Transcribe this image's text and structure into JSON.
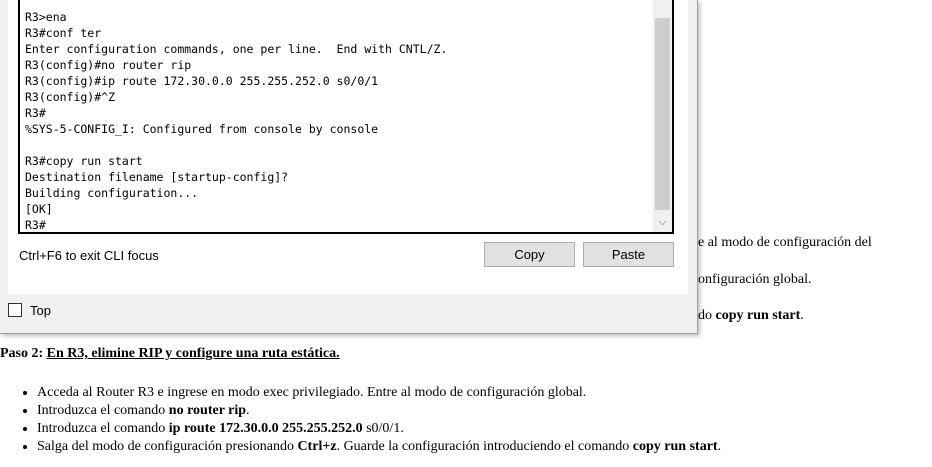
{
  "document": {
    "fragments": {
      "line1": "e al modo de configuración del",
      "line2": "onfiguración global.",
      "line3_pre": "do ",
      "line3_bold": "copy run start",
      "line3_post": "."
    },
    "step": {
      "prefix": "Paso 2: ",
      "title": "En R3, elimine RIP y configure una ruta estática."
    },
    "bullets": [
      {
        "pre": "Acceda al Router R3 e ingrese en modo exec privilegiado. Entre al modo de configuración global.",
        "b1": "",
        "mid": "",
        "b2": "",
        "post": ""
      },
      {
        "pre": "Introduzca el comando ",
        "b1": "no router rip",
        "mid": "",
        "b2": "",
        "post": "."
      },
      {
        "pre": "Introduzca el comando ",
        "b1": "ip route 172.30.0.0 255.255.252.0",
        "mid": " s0/0/1",
        "b2": "",
        "post": "."
      },
      {
        "pre": "Salga del modo de configuración presionando ",
        "b1": "Ctrl+z",
        "mid": ". Guarde la configuración introduciendo el comando ",
        "b2": "copy run start",
        "post": "."
      }
    ]
  },
  "cli": {
    "terminal_output": "R3>ena\nR3#conf ter\nEnter configuration commands, one per line.  End with CNTL/Z.\nR3(config)#no router rip\nR3(config)#ip route 172.30.0.0 255.255.252.0 s0/0/1\nR3(config)#^Z\nR3#\n%SYS-5-CONFIG_I: Configured from console by console\n\nR3#copy run start\nDestination filename [startup-config]?\nBuilding configuration...\n[OK]\nR3#",
    "hint": "Ctrl+F6 to exit CLI focus",
    "copy_label": "Copy",
    "paste_label": "Paste",
    "top_label": "Top",
    "top_checked": false,
    "scroll_down_glyph": "⌵"
  }
}
